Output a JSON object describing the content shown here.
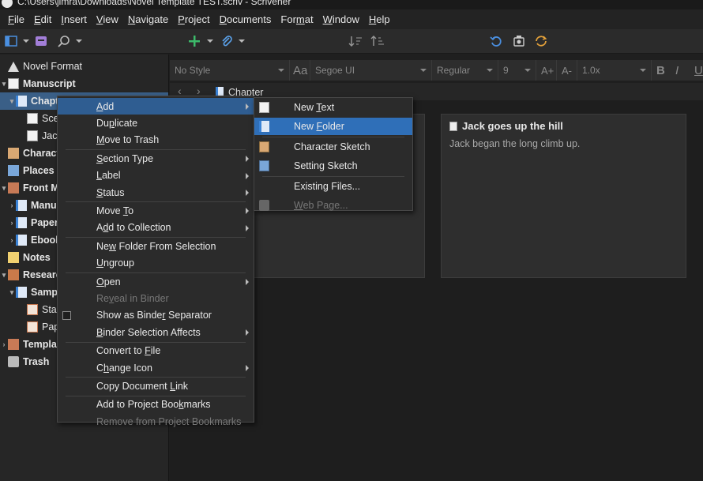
{
  "window": {
    "title": "C:\\Users\\jimra\\Downloads\\Novel Template TEST.scriv - Scrivener"
  },
  "menubar": [
    {
      "label": "File",
      "accel": "F"
    },
    {
      "label": "Edit",
      "accel": "E"
    },
    {
      "label": "Insert",
      "accel": "I"
    },
    {
      "label": "View",
      "accel": "V"
    },
    {
      "label": "Navigate",
      "accel": "N"
    },
    {
      "label": "Project",
      "accel": "P"
    },
    {
      "label": "Documents",
      "accel": "D"
    },
    {
      "label": "Format",
      "accel": "m"
    },
    {
      "label": "Window",
      "accel": "W"
    },
    {
      "label": "Help",
      "accel": "H"
    }
  ],
  "binder": [
    {
      "label": "Novel Format",
      "icon": "warning-icon",
      "bold": false
    },
    {
      "label": "Manuscript",
      "icon": "manuscript-icon",
      "bold": true
    },
    {
      "label": "Chapt",
      "icon": "folder-icon",
      "bold": true,
      "selected": true
    },
    {
      "label": "Scen",
      "icon": "document-icon",
      "bold": false
    },
    {
      "label": "Jack",
      "icon": "document-icon",
      "bold": false
    },
    {
      "label": "Charact",
      "icon": "characters-icon",
      "bold": true
    },
    {
      "label": "Places",
      "icon": "places-icon",
      "bold": true
    },
    {
      "label": "Front M",
      "icon": "front-matter-icon",
      "bold": true
    },
    {
      "label": "Manu",
      "icon": "folder-icon",
      "bold": true
    },
    {
      "label": "Paper",
      "icon": "folder-icon",
      "bold": true
    },
    {
      "label": "Ebool",
      "icon": "folder-icon",
      "bold": true
    },
    {
      "label": "Notes",
      "icon": "notes-icon",
      "bold": true
    },
    {
      "label": "Researc",
      "icon": "research-icon",
      "bold": true
    },
    {
      "label": "Samp",
      "icon": "folder-icon",
      "bold": true
    },
    {
      "label": "Star",
      "icon": "sheet-icon",
      "bold": false
    },
    {
      "label": "Pap",
      "icon": "sheet-icon",
      "bold": false
    },
    {
      "label": "Templa",
      "icon": "template-icon",
      "bold": true
    },
    {
      "label": "Trash",
      "icon": "trash-icon",
      "bold": true
    }
  ],
  "formatbar": {
    "style": "No Style",
    "font_icon": "Aa",
    "font": "Segoe UI",
    "weight": "Regular",
    "size": "9",
    "line_spacing": "1.0x",
    "bold": "B",
    "italic": "I",
    "underline": "U",
    "grow_font": "A+",
    "shrink_font": "A-"
  },
  "editor": {
    "header_title": "Chapter",
    "cards": [
      {
        "title": "Jack goes up the hill",
        "body": "Jack began the long climb up."
      }
    ]
  },
  "context_menu": [
    {
      "label": "Add",
      "accel": "A",
      "submenu": true,
      "active": true
    },
    {
      "label": "Duplicate",
      "accel": "p"
    },
    {
      "label": "Move to Trash",
      "accel": "M"
    },
    {
      "sep": true
    },
    {
      "label": "Section Type",
      "accel": "S",
      "submenu": true
    },
    {
      "label": "Label",
      "accel": "L",
      "submenu": true
    },
    {
      "label": "Status",
      "accel": "S",
      "submenu": true
    },
    {
      "sep": true
    },
    {
      "label": "Move To",
      "accel": "T",
      "submenu": true
    },
    {
      "label": "Add to Collection",
      "accel": "d",
      "submenu": true
    },
    {
      "sep": true
    },
    {
      "label": "New Folder From Selection",
      "accel": "w"
    },
    {
      "label": "Ungroup",
      "accel": "U"
    },
    {
      "sep": true
    },
    {
      "label": "Open",
      "accel": "O",
      "submenu": true
    },
    {
      "label": "Reveal in Binder",
      "accel": "v",
      "disabled": true
    },
    {
      "label": "Show as Binder Separator",
      "accel": "r",
      "checkbox": true
    },
    {
      "label": "Binder Selection Affects",
      "accel": "B",
      "submenu": true
    },
    {
      "sep": true
    },
    {
      "label": "Convert to File",
      "accel": "F"
    },
    {
      "label": "Change Icon",
      "accel": "h",
      "submenu": true
    },
    {
      "sep": true
    },
    {
      "label": "Copy Document Link",
      "accel": "L"
    },
    {
      "sep": true
    },
    {
      "label": "Add to Project Bookmarks",
      "accel": "k"
    },
    {
      "label": "Remove from Project Bookmarks",
      "accel": "",
      "disabled": true
    }
  ],
  "submenu": [
    {
      "label": "New Text",
      "accel": "T",
      "icon": "text-icon"
    },
    {
      "label": "New Folder",
      "accel": "F",
      "icon": "folder-icon",
      "active": true
    },
    {
      "sep": true
    },
    {
      "label": "Character Sketch",
      "accel": "",
      "icon": "character-sketch-icon"
    },
    {
      "label": "Setting Sketch",
      "accel": "",
      "icon": "setting-sketch-icon"
    },
    {
      "sep": true
    },
    {
      "label": "Existing Files...",
      "accel": "",
      "icon": ""
    },
    {
      "label": "Web Page...",
      "accel": "W",
      "icon": "web-page-icon",
      "disabled": true
    }
  ],
  "colors": {
    "background": "#1f1f1f",
    "menu_bg": "#2b2b2b",
    "menu_highlight": "#2f5d91",
    "submenu_highlight": "#2f6fb8",
    "binder_selected": "#3a5f87",
    "accent_blue": "#3b83d6",
    "accent_green": "#3cba6a",
    "accent_orange": "#e5a23a"
  }
}
